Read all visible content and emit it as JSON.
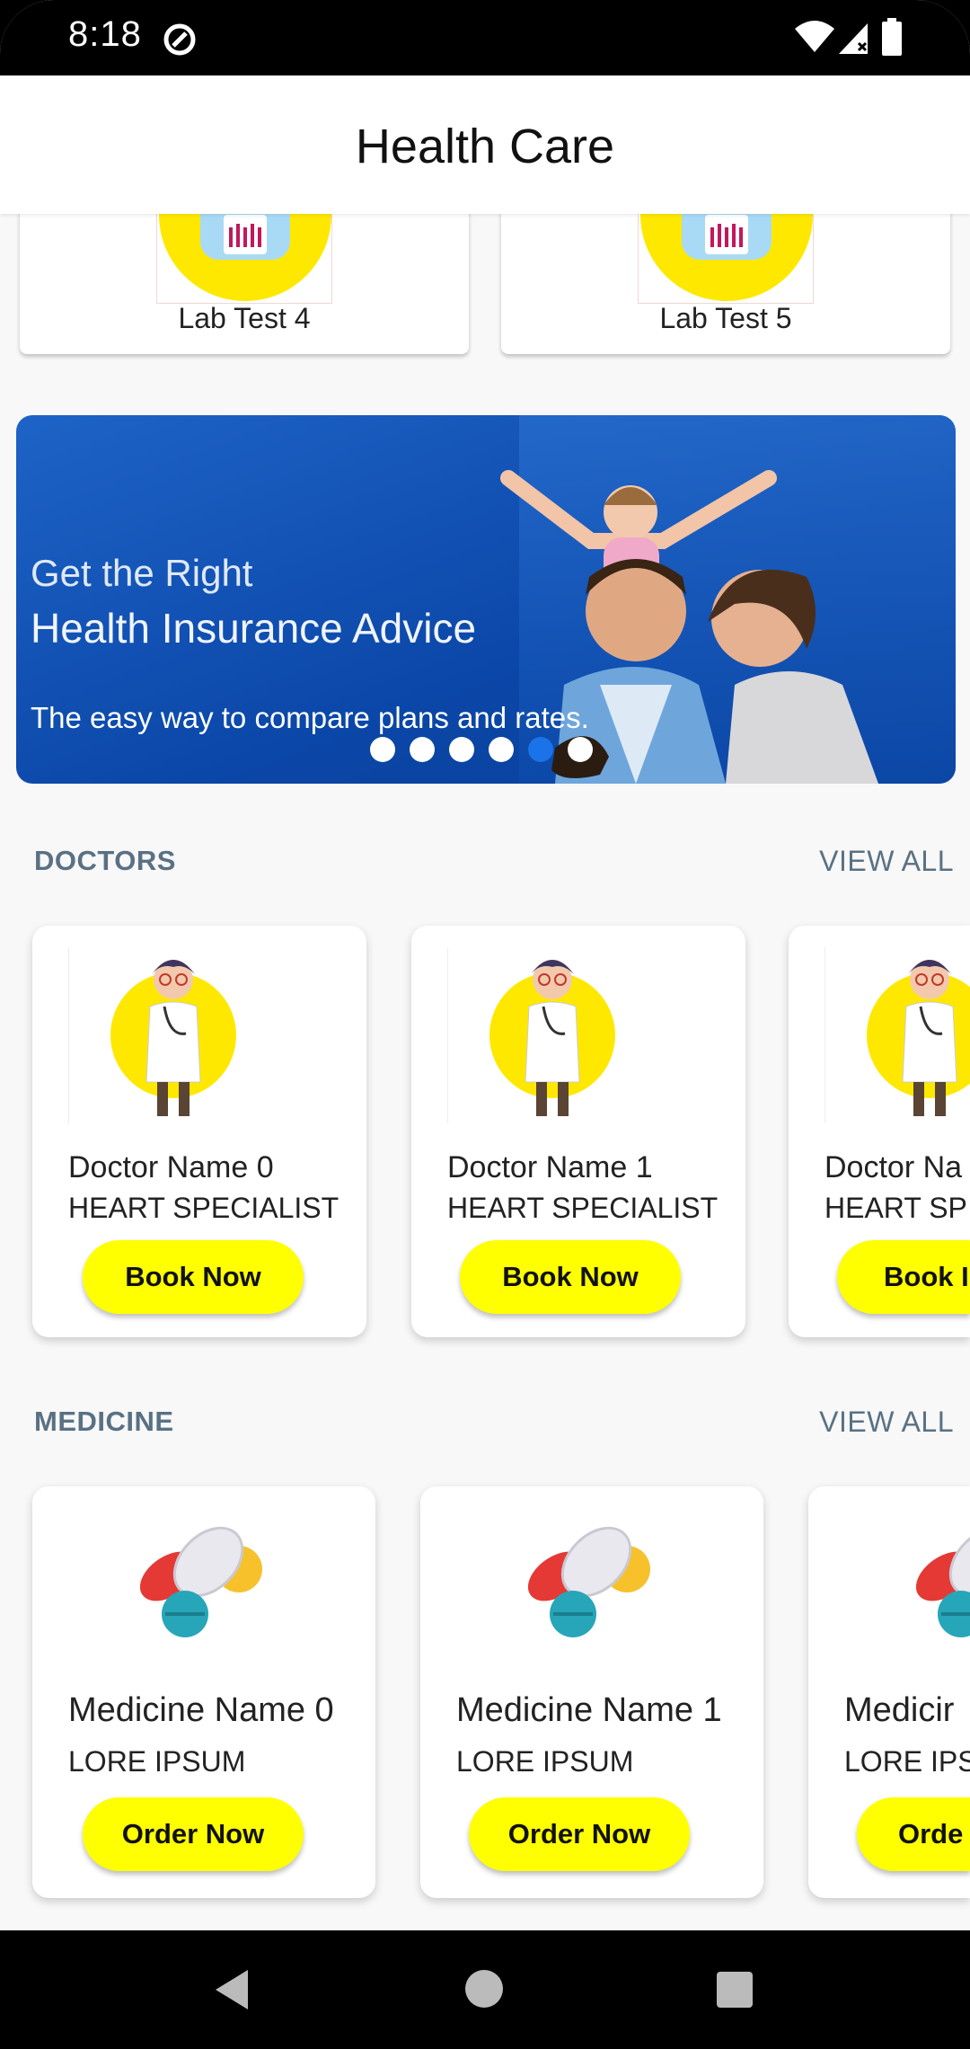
{
  "status": {
    "time": "8:18"
  },
  "app": {
    "title": "Health Care"
  },
  "lab_tests": [
    {
      "label": "Lab Test  4"
    },
    {
      "label": "Lab Test  5"
    }
  ],
  "banner": {
    "line1": "Get the Right",
    "line2": "Health Insurance Advice",
    "line3": "The easy way to compare plans and rates.",
    "slide_count": 6,
    "active_index": 4
  },
  "doctors": {
    "title": "DOCTORS",
    "view_all": "VIEW ALL",
    "items": [
      {
        "name": "Doctor Name 0",
        "specialty": "HEART SPECIALIST",
        "button": "Book Now"
      },
      {
        "name": "Doctor Name 1",
        "specialty": "HEART SPECIALIST",
        "button": "Book Now"
      },
      {
        "name": "Doctor Na",
        "specialty": "HEART SP",
        "button": "Book I"
      }
    ]
  },
  "medicine": {
    "title": "MEDICINE",
    "view_all": "VIEW ALL",
    "items": [
      {
        "name": "Medicine Name 0",
        "desc": "LORE IPSUM",
        "button": "Order Now"
      },
      {
        "name": "Medicine Name 1",
        "desc": "LORE IPSUM",
        "button": "Order Now"
      },
      {
        "name": "Medicir",
        "desc": "LORE IPS",
        "button": "Orde"
      }
    ]
  },
  "colors": {
    "accent_yellow": "#ffff00",
    "section_text": "#5a7184",
    "banner_blue": "#0b47a8",
    "active_dot": "#1a73e8"
  },
  "icons": {
    "status": [
      "data-saver-icon",
      "wifi-icon",
      "signal-icon",
      "battery-icon"
    ],
    "nav": [
      "back-icon",
      "home-icon",
      "recents-icon"
    ]
  }
}
